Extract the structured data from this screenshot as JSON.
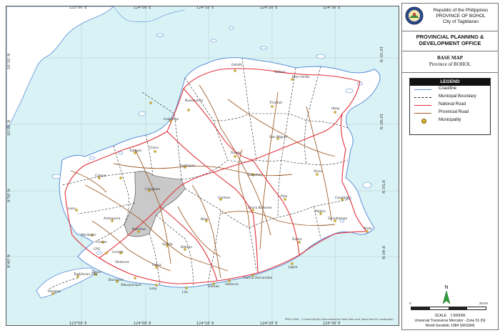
{
  "header": {
    "republic": "Republic of the Philippines",
    "province": "PROVINCE OF BOHOL",
    "city": "City of Tagbilaran",
    "office": "PROVINCIAL PLANNING & DEVELOPMENT OFFICE",
    "map_title": "BASE MAP",
    "map_subtitle": "Province of BOHOL"
  },
  "legend": {
    "title": "LEGEND",
    "items": [
      {
        "label": "Coastline",
        "color": "#5b8fd8"
      },
      {
        "label": "Municipal Boundary",
        "color": "#222222"
      },
      {
        "label": "National Road",
        "color": "#e0303a"
      },
      {
        "label": "Provincial Road",
        "color": "#a0602e"
      },
      {
        "label": "Municipality",
        "color": "#d9b52a"
      }
    ]
  },
  "scale": {
    "label": "SCALE",
    "ratio": "1:500000",
    "start": "0",
    "end": "20 km"
  },
  "projection": {
    "line1": "Universal Transverse Mercator - Zone 51 (N)",
    "line2": "World Geodetic 1984 (WGS84)"
  },
  "north_label": "N",
  "ticks": {
    "top": [
      "123°50' E",
      "124°00' E",
      "124°10' E",
      "124°20' E",
      "124°30' E"
    ],
    "bottom": [
      "123°50' E",
      "124°00' E",
      "124°10' E",
      "124°20' E",
      "124°30' E"
    ],
    "left": [
      "10°10' N",
      "10°00' N",
      "9°50' N",
      "9°40' N"
    ],
    "right": [
      "10°10' N",
      "10°00' N",
      "9°50' N",
      "9°40' N"
    ]
  },
  "credit": "PPDO-GISd - C:\\Users\\Gis\\My Documents\\Arc Base Map.mxd (Base Map A4 Landscape)",
  "towns": [
    "Tubigon",
    "Clarin",
    "Inabanga",
    "Buenavista",
    "Getafe",
    "Talibon",
    "Bien Unido",
    "Trinidad",
    "Ubay",
    "San Miguel",
    "Danao",
    "Dagohoy",
    "Sagbayan",
    "Calape",
    "Loon",
    "Maribojoc",
    "Antequera",
    "Catigbian",
    "Balilihan",
    "Corella",
    "Sikatuna",
    "Cortes",
    "Baclayon",
    "Albuquerque",
    "Loay",
    "Lila",
    "Dimiao",
    "Valencia",
    "Garcia Hernandez",
    "Jagna",
    "Duero",
    "Guindulman",
    "Anda",
    "Candijay",
    "Mabini",
    "Alicia",
    "Pilar",
    "Sierra Bullones",
    "Carmen",
    "Bilar",
    "Batuan",
    "Sevilla",
    "Loboc",
    "Dauis",
    "Panglao",
    "Tagbilaran City",
    "CPG"
  ],
  "roads": {
    "national": "National Road",
    "provincial": "Provincial Road"
  }
}
